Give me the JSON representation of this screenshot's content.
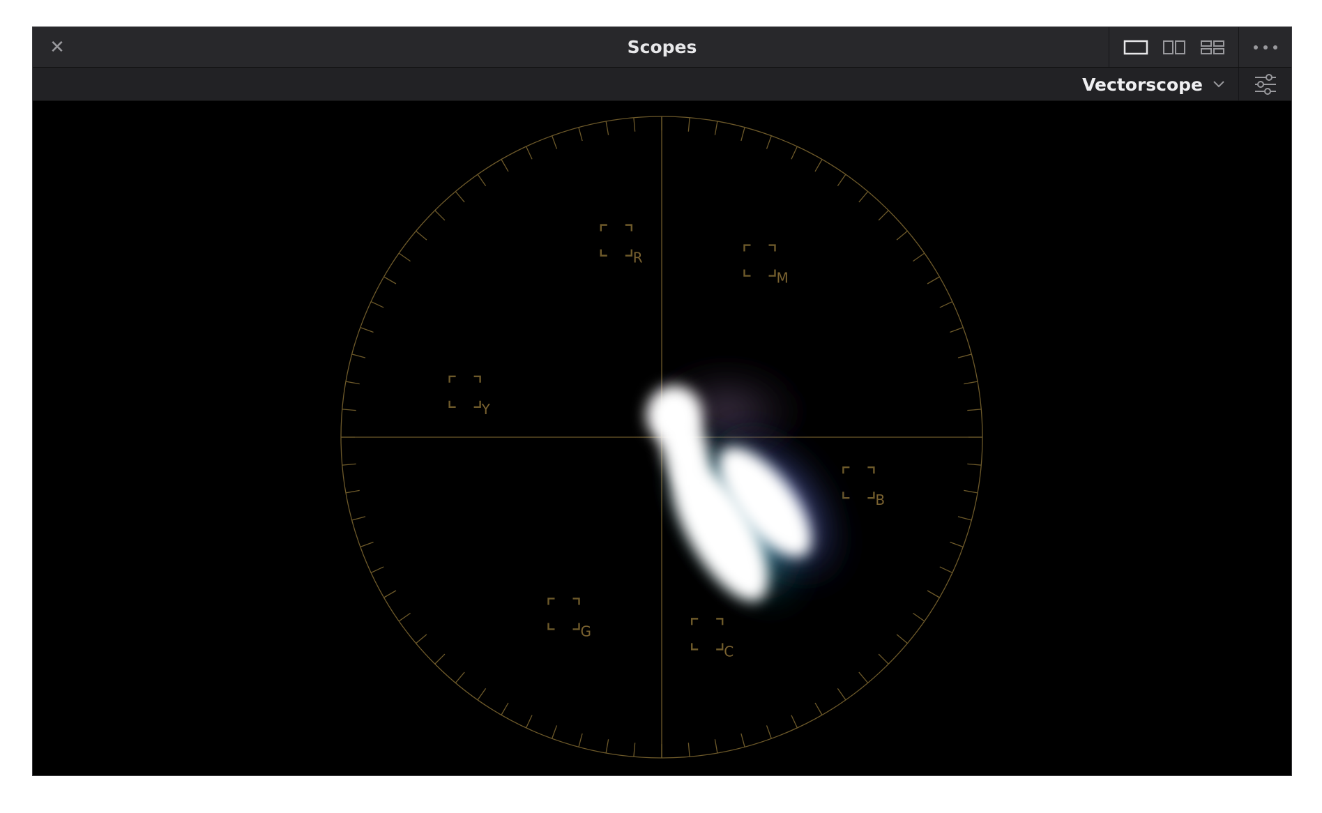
{
  "window": {
    "title": "Scopes"
  },
  "titlebar": {
    "close_icon": "close-icon",
    "layout_buttons": [
      {
        "name": "single-view-icon",
        "active": true
      },
      {
        "name": "dual-view-icon",
        "active": false
      },
      {
        "name": "quad-view-icon",
        "active": false
      }
    ],
    "more_icon": "more-options-icon"
  },
  "toolbar": {
    "scope_type": "Vectorscope",
    "dropdown_icon": "chevron-down-icon",
    "settings_icon": "settings-sliders-icon"
  },
  "vectorscope": {
    "graticule_color": "#6e5a2a",
    "label_color": "#7a6230",
    "targets": [
      {
        "label": "R",
        "angle_deg": 103
      },
      {
        "label": "M",
        "angle_deg": 61
      },
      {
        "label": "B",
        "angle_deg": 347
      },
      {
        "label": "C",
        "angle_deg": 283
      },
      {
        "label": "G",
        "angle_deg": 241
      },
      {
        "label": "Y",
        "angle_deg": 167
      }
    ]
  },
  "colors": {
    "titlebar_bg": "#28282b",
    "toolbar_bg": "#222225",
    "scope_bg": "#000000",
    "icon": "#9a9a9e"
  }
}
